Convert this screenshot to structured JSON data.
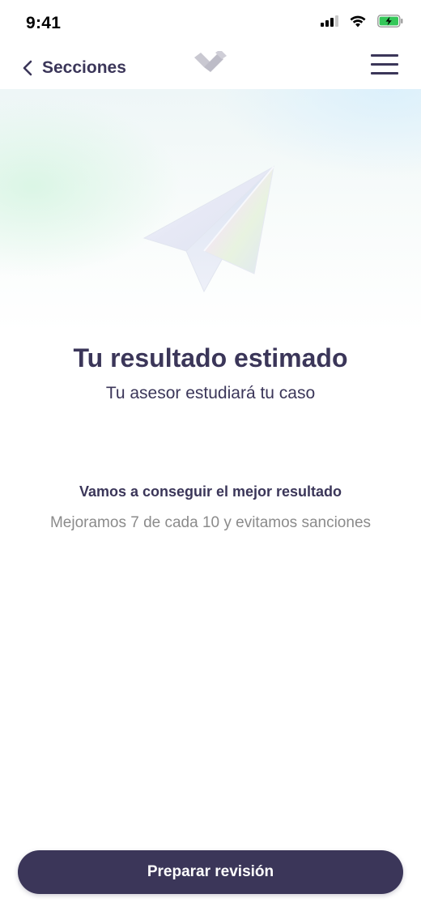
{
  "status": {
    "time": "9:41",
    "icons": [
      "cellular-signal-icon",
      "wifi-icon",
      "battery-charging-icon"
    ]
  },
  "nav": {
    "back_label": "Secciones",
    "logo": "app-logo-icon",
    "menu": "hamburger-menu-icon"
  },
  "hero": {
    "illustration": "paper-plane-icon"
  },
  "content": {
    "title": "Tu resultado estimado",
    "subtitle": "Tu asesor estudiará tu caso",
    "info_heading": "Vamos a conseguir el mejor resultado",
    "info_text": "Mejoramos 7 de cada 10 y evitamos sanciones"
  },
  "actions": {
    "primary_label": "Preparar revisión"
  },
  "colors": {
    "primary": "#3b3659",
    "muted_text": "#8b8b8b",
    "battery_green": "#34c759"
  }
}
